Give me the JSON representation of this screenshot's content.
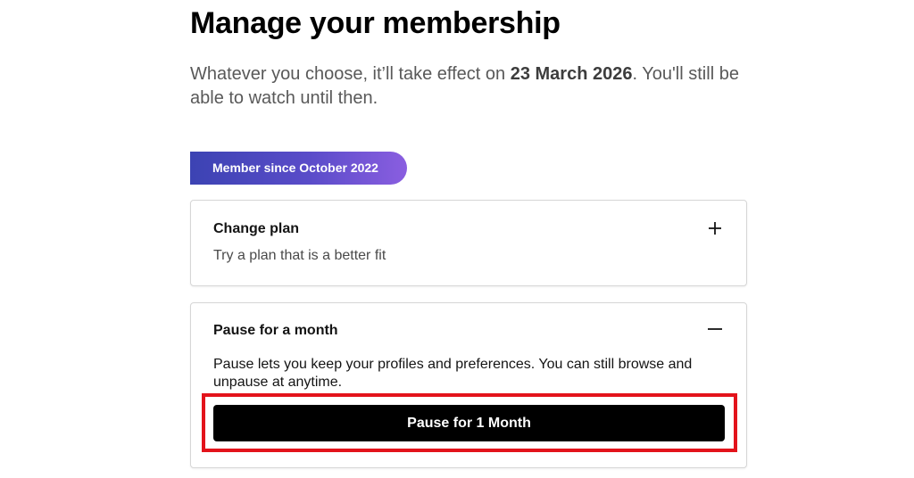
{
  "page": {
    "title": "Manage your membership",
    "subtitle_prefix": "Whatever you choose, it’ll take effect on ",
    "effective_date": "23 March 2026",
    "subtitle_suffix": ". You'll still be able to watch until then."
  },
  "badge": {
    "label": "Member since October 2022",
    "gradient_start": "#3c43b3",
    "gradient_end": "#8a5ee0"
  },
  "options": {
    "change_plan": {
      "title": "Change plan",
      "description": "Try a plan that is a better fit",
      "icon": "plus-icon",
      "expanded": false
    },
    "pause": {
      "title": "Pause for a month",
      "description": "Pause lets you keep your profiles and preferences. You can still browse and unpause at anytime.",
      "icon": "minus-icon",
      "expanded": true,
      "button_label": "Pause for 1 Month"
    }
  },
  "annotation": {
    "highlight_color": "#e3131b"
  }
}
